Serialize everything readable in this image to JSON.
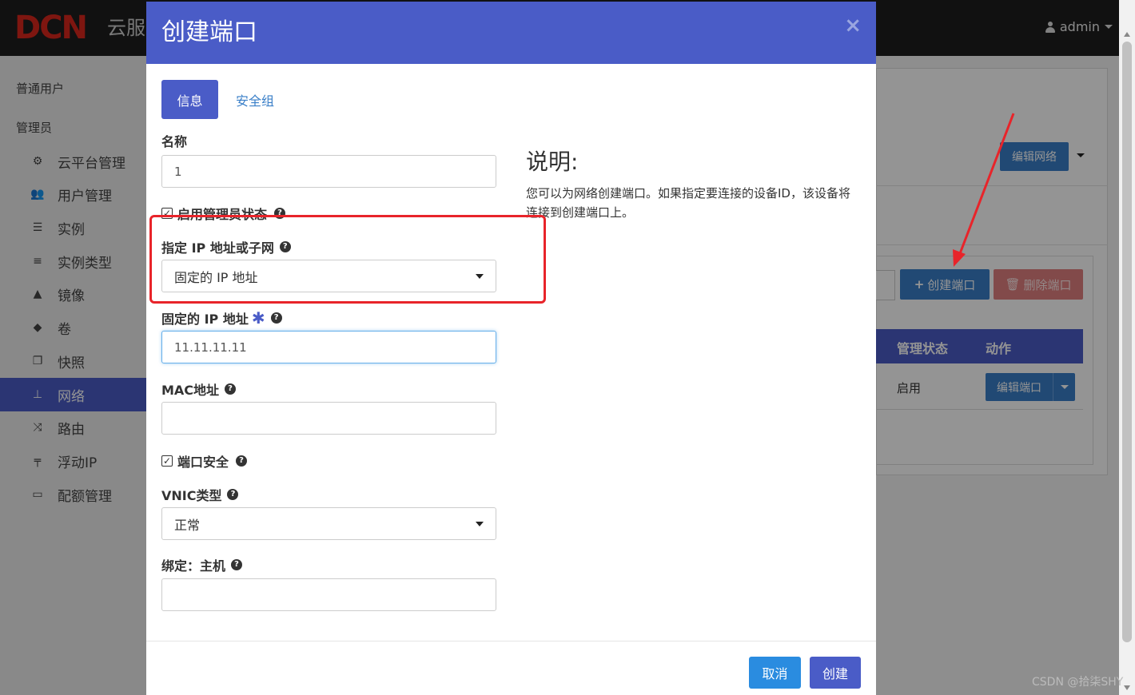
{
  "app": {
    "logo_text": "DCN",
    "logo_sub": "云服",
    "user": "admin"
  },
  "sidebar": {
    "groups": [
      "普通用户",
      "管理员"
    ],
    "items": [
      {
        "label": "云平台管理",
        "icon": "cogs-icon"
      },
      {
        "label": "用户管理",
        "icon": "users-icon"
      },
      {
        "label": "实例",
        "icon": "server-icon"
      },
      {
        "label": "实例类型",
        "icon": "list-icon"
      },
      {
        "label": "镜像",
        "icon": "image-icon"
      },
      {
        "label": "卷",
        "icon": "cube-icon"
      },
      {
        "label": "快照",
        "icon": "copy-icon"
      },
      {
        "label": "网络",
        "icon": "sitemap-icon",
        "active": true
      },
      {
        "label": "路由",
        "icon": "random-icon"
      },
      {
        "label": "浮动IP",
        "icon": "signpost-icon"
      },
      {
        "label": "配额管理",
        "icon": "battery-icon"
      }
    ]
  },
  "background": {
    "edit_network": "编辑网络",
    "create_port": "创建端口",
    "delete_port": "删除端口",
    "col_admin_state": "管理状态",
    "col_action": "动作",
    "row_status": "启用",
    "edit_port": "编辑端口"
  },
  "modal": {
    "title": "创建端口",
    "close": "×",
    "tabs": {
      "info": "信息",
      "security_group": "安全组"
    },
    "name": {
      "label": "名称",
      "value": "1"
    },
    "admin_state": {
      "label": "启用管理员状态",
      "checked": true
    },
    "specify_ip": {
      "label": "指定 IP 地址或子网",
      "value": "固定的 IP 地址"
    },
    "fixed_ip": {
      "label": "固定的 IP 地址",
      "required": "✱",
      "value": "11.11.11.11"
    },
    "mac": {
      "label": "MAC地址",
      "value": ""
    },
    "port_security": {
      "label": "端口安全",
      "checked": true
    },
    "vnic": {
      "label": "VNIC类型",
      "value": "正常"
    },
    "binding_host": {
      "label": "绑定：主机",
      "value": ""
    },
    "description": {
      "title": "说明:",
      "text": "您可以为网络创建端口。如果指定要连接的设备ID，该设备将连接到创建端口上。"
    },
    "buttons": {
      "cancel": "取消",
      "create": "创建"
    }
  },
  "watermark": "CSDN @拾柒SHY",
  "colors": {
    "primary": "#4a5cc7",
    "blue_button": "#3a7fc8",
    "annotation_red": "#e8242a"
  }
}
